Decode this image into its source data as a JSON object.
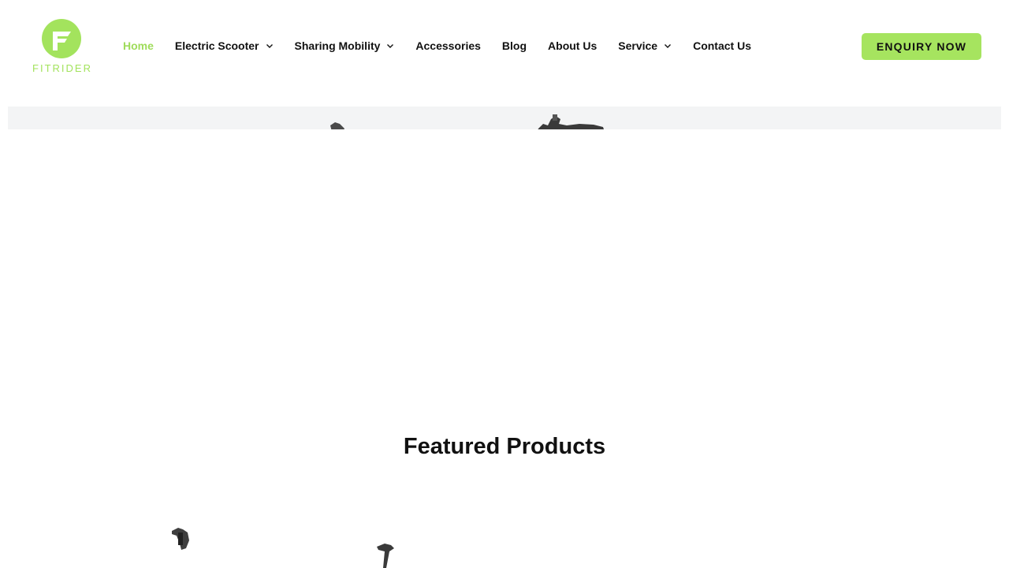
{
  "brand": {
    "name": "FITRIDER",
    "logo_icon": "fitrider-logo-icon",
    "accent_color": "#a3e35d"
  },
  "nav": {
    "items": [
      {
        "label": "Home",
        "active": true,
        "has_dropdown": false
      },
      {
        "label": "Electric Scooter",
        "active": false,
        "has_dropdown": true
      },
      {
        "label": "Sharing Mobility",
        "active": false,
        "has_dropdown": true
      },
      {
        "label": "Accessories",
        "active": false,
        "has_dropdown": false
      },
      {
        "label": "Blog",
        "active": false,
        "has_dropdown": false
      },
      {
        "label": "About Us",
        "active": false,
        "has_dropdown": false
      },
      {
        "label": "Service",
        "active": false,
        "has_dropdown": true
      },
      {
        "label": "Contact Us",
        "active": false,
        "has_dropdown": false
      }
    ],
    "active_color": "#9fdc5b"
  },
  "cta": {
    "label": "ENQUIRY NOW",
    "color": "#a6e45f"
  },
  "sections": {
    "featured_title": "Featured Products"
  }
}
